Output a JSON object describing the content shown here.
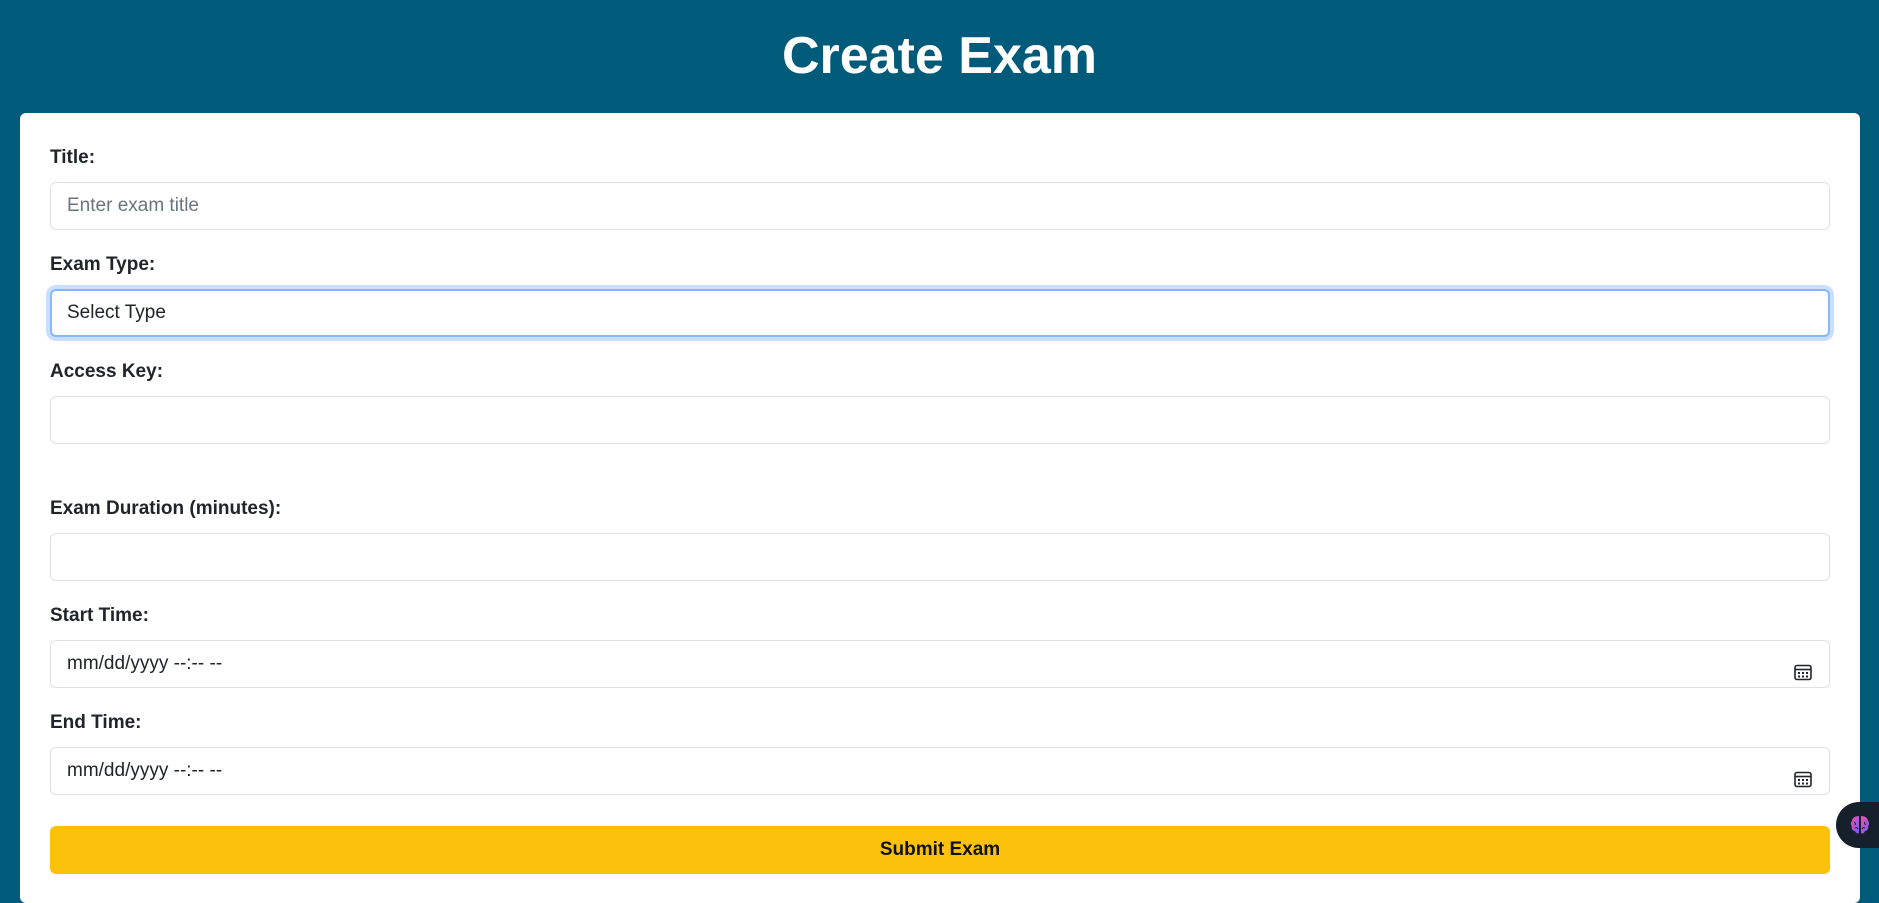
{
  "header": {
    "title": "Create Exam"
  },
  "form": {
    "title": {
      "label": "Title:",
      "placeholder": "Enter exam title",
      "value": ""
    },
    "exam_type": {
      "label": "Exam Type:",
      "selected": "Select Type"
    },
    "access_key": {
      "label": "Access Key:",
      "value": ""
    },
    "duration": {
      "label": "Exam Duration (minutes):",
      "value": ""
    },
    "start_time": {
      "label": "Start Time:",
      "display": "mm/dd/yyyy --:-- --"
    },
    "end_time": {
      "label": "End Time:",
      "display": "mm/dd/yyyy --:-- --"
    },
    "submit_label": "Submit Exam"
  },
  "widget": {
    "icon": "brain-icon"
  },
  "colors": {
    "page_background": "#005a7a",
    "submit_button": "#fcc10b",
    "focus_ring": "#86b7fe"
  }
}
